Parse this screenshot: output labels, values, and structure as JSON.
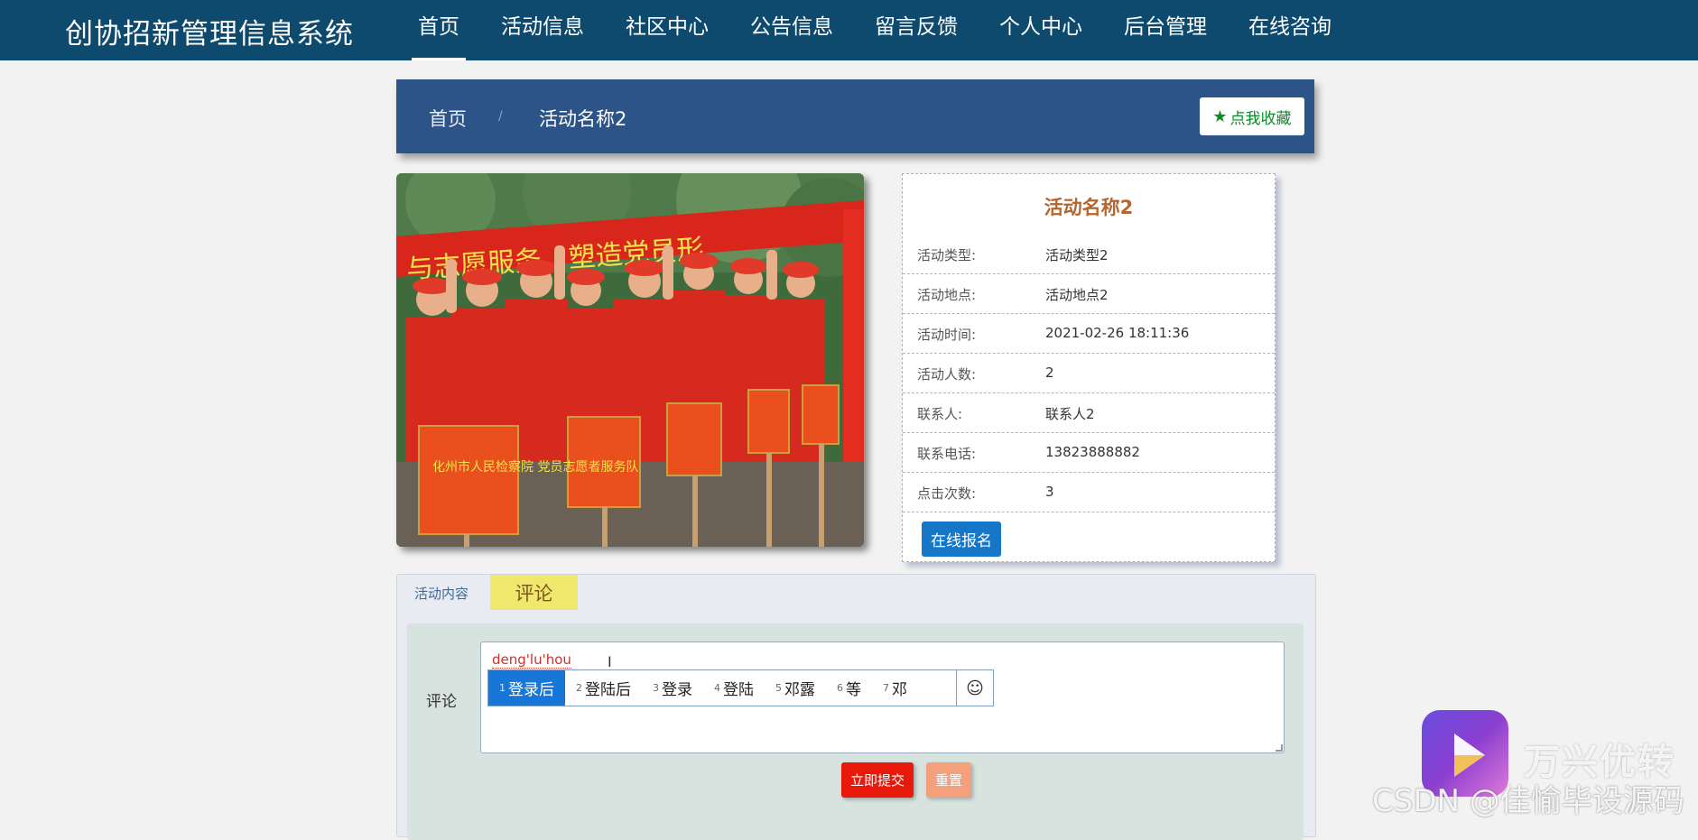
{
  "app": {
    "title": "创协招新管理信息系统"
  },
  "nav": [
    {
      "label": "首页",
      "active": true
    },
    {
      "label": "活动信息"
    },
    {
      "label": "社区中心"
    },
    {
      "label": "公告信息"
    },
    {
      "label": "留言反馈"
    },
    {
      "label": "个人中心"
    },
    {
      "label": "后台管理"
    },
    {
      "label": "在线咨询"
    }
  ],
  "breadcrumb": {
    "home": "首页",
    "separator": "/",
    "current": "活动名称2"
  },
  "favorite_button": "点我收藏",
  "detail": {
    "title": "活动名称2",
    "rows": [
      {
        "key": "活动类型:",
        "value": "活动类型2"
      },
      {
        "key": "活动地点:",
        "value": "活动地点2"
      },
      {
        "key": "活动时间:",
        "value": "2021-02-26 18:11:36"
      },
      {
        "key": "活动人数:",
        "value": "2"
      },
      {
        "key": "联系人:",
        "value": "联系人2"
      },
      {
        "key": "联系电话:",
        "value": "13823888882"
      },
      {
        "key": "点击次数:",
        "value": "3"
      }
    ],
    "signup_button": "在线报名"
  },
  "tabs": {
    "content": "活动内容",
    "comment": "评论"
  },
  "comment_form": {
    "label": "评论",
    "typed": "deng'lu'hou",
    "submit": "立即提交",
    "reset": "重置"
  },
  "ime": {
    "candidates": [
      {
        "n": "1",
        "text": "登录后"
      },
      {
        "n": "2",
        "text": "登陆后"
      },
      {
        "n": "3",
        "text": "登录"
      },
      {
        "n": "4",
        "text": "登陆"
      },
      {
        "n": "5",
        "text": "邓露"
      },
      {
        "n": "6",
        "text": "等"
      },
      {
        "n": "7",
        "text": "邓"
      }
    ],
    "emoji": "☺"
  },
  "photo_banner": {
    "banner": "与志愿服务，塑造党员形",
    "sign_left": "化州市人民检察院 党员志愿者服务队"
  },
  "watermark": {
    "app_name": "万兴优转",
    "csdn": "CSDN @佳愉毕设源码"
  },
  "colors": {
    "topbar": "#0d4a6e",
    "crumbbar": "#2d5489",
    "submit": "#e8180a",
    "reset": "#f4a07c",
    "tab_active": "#efe86c",
    "signup": "#1677c9"
  }
}
